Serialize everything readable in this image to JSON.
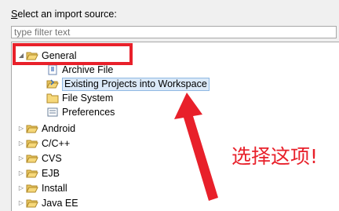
{
  "dialog": {
    "prompt_underlined": "S",
    "prompt_rest": "elect an import source:",
    "filter_placeholder": "type filter text"
  },
  "tree": {
    "general": "General",
    "children": [
      "Archive File",
      "Existing Projects into Workspace",
      "File System",
      "Preferences"
    ],
    "categories": [
      "Android",
      "C/C++",
      "CVS",
      "EJB",
      "Install",
      "Java EE"
    ]
  },
  "annotation": {
    "text": "选择这项!",
    "color": "#e8202a"
  }
}
